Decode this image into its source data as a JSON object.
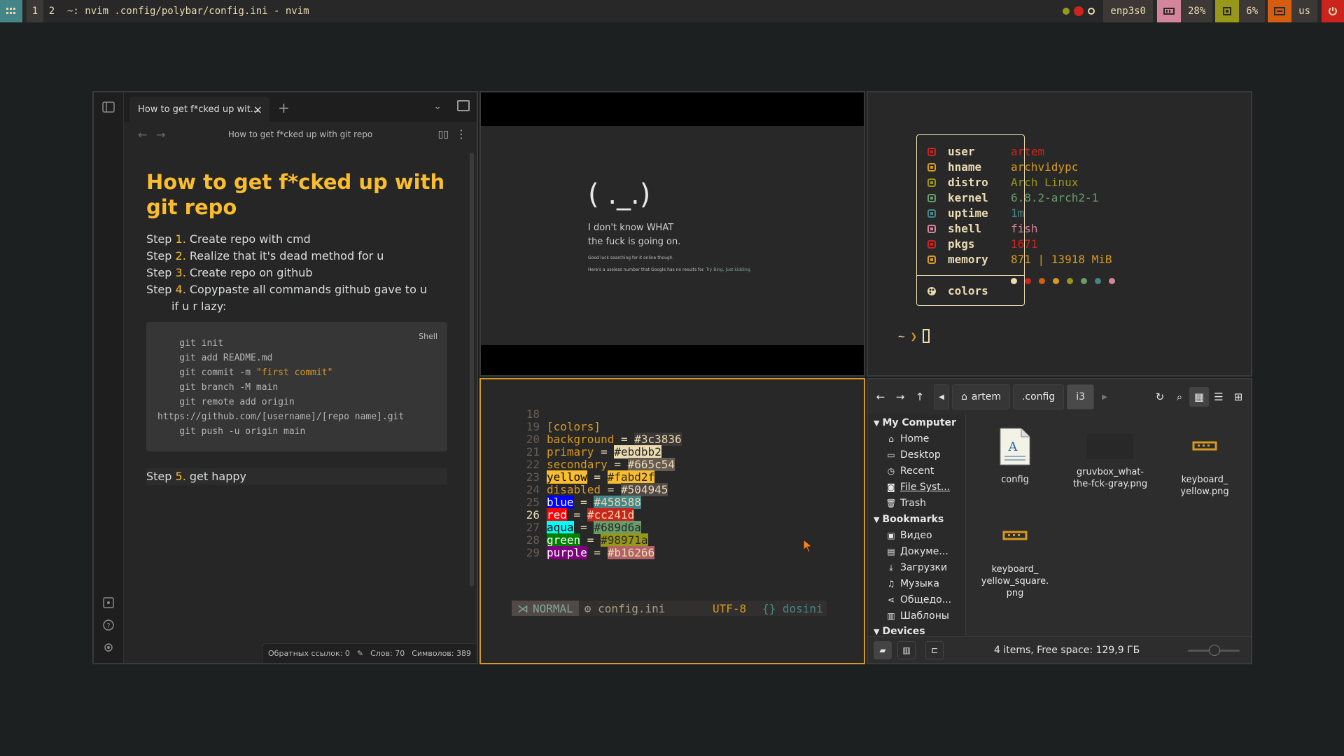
{
  "bar": {
    "workspaces": [
      "1",
      "2"
    ],
    "window_title": "~: nvim .config/polybar/config.ini - nvim",
    "network": "enp3s0",
    "memory": "28%",
    "cpu": "6%",
    "layout": "us"
  },
  "obsidian": {
    "tab_title": "How to get f*cked up wit...",
    "nav_title": "How to get f*cked up with git repo",
    "heading": "How to get f*cked up with git repo",
    "step_word": "Step",
    "steps": [
      {
        "num": "1.",
        "text": " Create repo with cmd"
      },
      {
        "num": "2.",
        "text": " Realize that it's dead method for u"
      },
      {
        "num": "3.",
        "text": " Create repo on github"
      },
      {
        "num": "4.",
        "text": " Copypaste all commands github gave to u"
      }
    ],
    "step4_cont": "if u r lazy:",
    "code_lang": "Shell",
    "code": {
      "l1": "    git init",
      "l2": "    git add README.md",
      "l3a": "    git commit -m ",
      "l3b": "\"first commit\"",
      "l4": "    git branch -M main",
      "l5": "    git remote add origin",
      "l6": "https://github.com/[username]/[repo name].git",
      "l7": "    git push -u origin main"
    },
    "step5_num": "5.",
    "step5_text": " get happy",
    "status": {
      "backlinks": "Обратных ссылок: 0",
      "words": "Слов: 70",
      "chars": "Символов: 389"
    }
  },
  "browser": {
    "face": "( ._.)",
    "msg1": "I don't know WHAT",
    "msg2": "the fuck is going on.",
    "small1": "Good luck searching for it online though.",
    "small2": "Here's a useless number that Google has no results for.",
    "small2_link": " Try Bing. Just kidding."
  },
  "fetch": {
    "rows": [
      {
        "key": "user",
        "value": "artem",
        "color": "#cc241d",
        "icon": "user-icon"
      },
      {
        "key": "hname",
        "value": "archvidypc",
        "color": "#d79921",
        "icon": "hostname-icon"
      },
      {
        "key": "distro",
        "value": "Arch Linux",
        "color": "#98971a",
        "icon": "distro-icon"
      },
      {
        "key": "kernel",
        "value": "6.8.2-arch2-1",
        "color": "#689d6a",
        "icon": "kernel-icon"
      },
      {
        "key": "uptime",
        "value": "1m",
        "color": "#458588",
        "icon": "clock-icon"
      },
      {
        "key": "shell",
        "value": "fish",
        "color": "#d3869b",
        "icon": "terminal-icon"
      },
      {
        "key": "pkgs",
        "value": "1671",
        "color": "#cc241d",
        "icon": "package-icon"
      },
      {
        "key": "memory",
        "value": "871 | 13918 MiB",
        "color": "#d79921",
        "icon": "memory-icon"
      }
    ],
    "colors_key": "colors",
    "palette": [
      "#ebdbb2",
      "#cc241d",
      "#d65d0e",
      "#d79921",
      "#98971a",
      "#689d6a",
      "#458588",
      "#d3869b"
    ],
    "prompt": "~"
  },
  "nvim": {
    "lines": [
      {
        "n": "18",
        "t": ""
      },
      {
        "n": "19",
        "t": "[colors]"
      },
      {
        "n": "20",
        "k": "background",
        "v": "#3c3836"
      },
      {
        "n": "21",
        "k": "primary",
        "v": "#ebdbb2"
      },
      {
        "n": "22",
        "k": "secondary",
        "v": "#665c54"
      },
      {
        "n": "23",
        "k": "yellow",
        "v": "#fabd2f"
      },
      {
        "n": "24",
        "k": "disabled",
        "v": "#504945"
      },
      {
        "n": "25",
        "k": "blue",
        "v": "#458588"
      },
      {
        "n": "26",
        "k": "red",
        "v": "#cc241d"
      },
      {
        "n": "27",
        "k": "aqua",
        "v": "#689d6a"
      },
      {
        "n": "28",
        "k": "green",
        "v": "#98971a"
      },
      {
        "n": "29",
        "k": "purple",
        "v": "#b16266"
      }
    ],
    "mode": "NORMAL",
    "file": "config.ini",
    "encoding": "UTF-8",
    "filetype": "{} dosini"
  },
  "fm": {
    "crumbs": [
      "artem",
      ".config",
      "i3"
    ],
    "sections": {
      "computer": "My Computer",
      "bookmarks": "Bookmarks",
      "devices": "Devices"
    },
    "computer_items": [
      "Home",
      "Desktop",
      "Recent",
      "File Syst...",
      "Trash"
    ],
    "bookmark_items": [
      "Видео",
      "Докуме...",
      "Загрузки",
      "Музыка",
      "Общедо...",
      "Шаблоны"
    ],
    "files": [
      {
        "name": "config"
      },
      {
        "name": "gruvbox_what-the-fck-gray.png"
      },
      {
        "name": "keyboard_ yellow.png"
      },
      {
        "name": "keyboard_ yellow_square. png"
      }
    ],
    "status": "4 items, Free space: 129,9 ГБ"
  }
}
